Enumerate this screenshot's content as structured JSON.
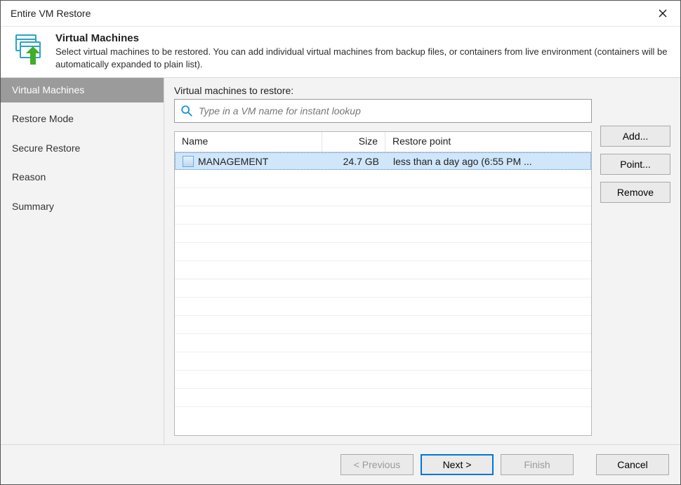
{
  "window": {
    "title": "Entire VM Restore"
  },
  "header": {
    "heading": "Virtual Machines",
    "subheading": "Select virtual machines to be restored. You  can add individual virtual machines from backup files, or containers from live environment (containers will be automatically expanded to plain list)."
  },
  "sidebar": {
    "items": [
      {
        "label": "Virtual Machines",
        "active": true
      },
      {
        "label": "Restore Mode"
      },
      {
        "label": "Secure Restore"
      },
      {
        "label": "Reason"
      },
      {
        "label": "Summary"
      }
    ]
  },
  "main": {
    "section_label": "Virtual machines to restore:",
    "search": {
      "placeholder": "Type in a VM name for instant lookup"
    },
    "columns": {
      "name": "Name",
      "size": "Size",
      "restore_point": "Restore point"
    },
    "rows": [
      {
        "name": "MANAGEMENT",
        "size": "24.7 GB",
        "restore_point": "less than a day ago (6:55 PM ..."
      }
    ],
    "side_buttons": {
      "add": "Add...",
      "point": "Point...",
      "remove": "Remove"
    }
  },
  "footer": {
    "previous": "< Previous",
    "next": "Next >",
    "finish": "Finish",
    "cancel": "Cancel"
  }
}
